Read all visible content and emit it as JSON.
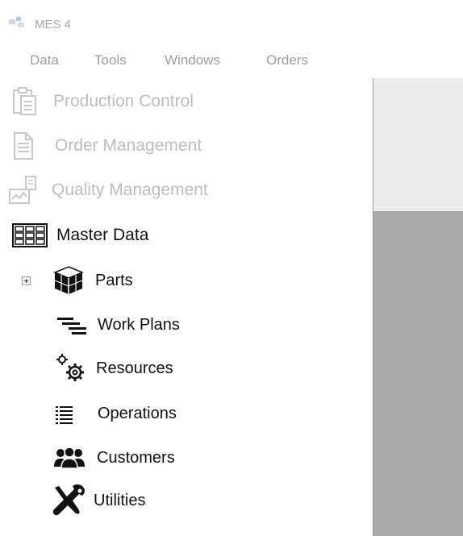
{
  "window": {
    "title": "MES 4"
  },
  "menu": {
    "items": [
      {
        "label": "Data"
      },
      {
        "label": "Tools"
      },
      {
        "label": "Windows"
      },
      {
        "label": "Orders"
      }
    ]
  },
  "sidebar": {
    "items": [
      {
        "label": "Production Control",
        "state": "disabled",
        "icon": "clipboard-document-icon"
      },
      {
        "label": "Order Management",
        "state": "disabled",
        "icon": "document-icon"
      },
      {
        "label": "Quality Management",
        "state": "disabled",
        "icon": "chart-document-icon"
      },
      {
        "label": "Master Data",
        "state": "enabled",
        "icon": "grid-table-icon"
      }
    ],
    "master_data_children": [
      {
        "label": "Parts",
        "icon": "cubes-icon",
        "expandable": true
      },
      {
        "label": "Work Plans",
        "icon": "gantt-bars-icon"
      },
      {
        "label": "Resources",
        "icon": "gears-icon"
      },
      {
        "label": "Operations",
        "icon": "list-lines-icon"
      },
      {
        "label": "Customers",
        "icon": "users-group-icon"
      },
      {
        "label": "Utilities",
        "icon": "wrench-screwdriver-icon"
      }
    ]
  },
  "colors": {
    "disabled_text": "#bdbdbd",
    "menu_text": "#9e9e9e",
    "content_bg": "#a8a8a8",
    "content_top_bg": "#ececec"
  }
}
